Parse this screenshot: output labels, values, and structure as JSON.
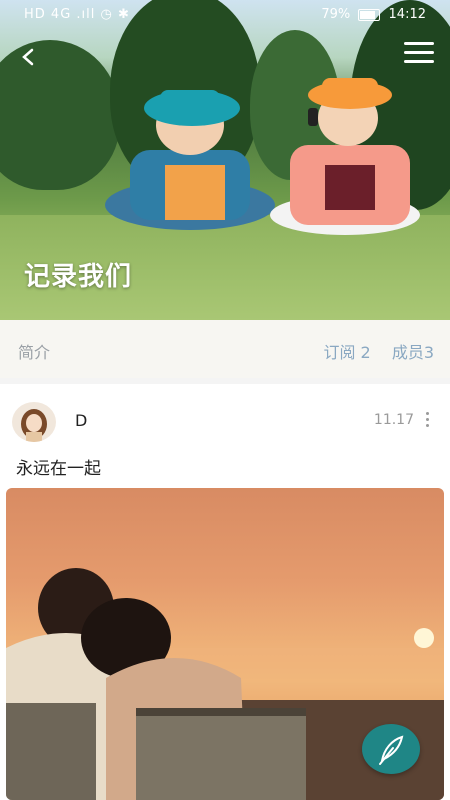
{
  "status_bar": {
    "left": "HD 4G .ıll ◷ ✱",
    "battery": "79%",
    "time": "14:12"
  },
  "group": {
    "title": "记录我们"
  },
  "info": {
    "intro_label": "简介",
    "subscriptions": "订阅 2",
    "members": "成员3"
  },
  "post": {
    "author": "D",
    "date": "11.17",
    "text": "永远在一起"
  },
  "icons": {
    "back": "back-arrow-icon",
    "menu": "menu-icon",
    "more": "more-vertical-icon",
    "compose": "feather-icon"
  },
  "colors": {
    "accent": "#1f8686",
    "stats_text": "#8aa8c2"
  }
}
